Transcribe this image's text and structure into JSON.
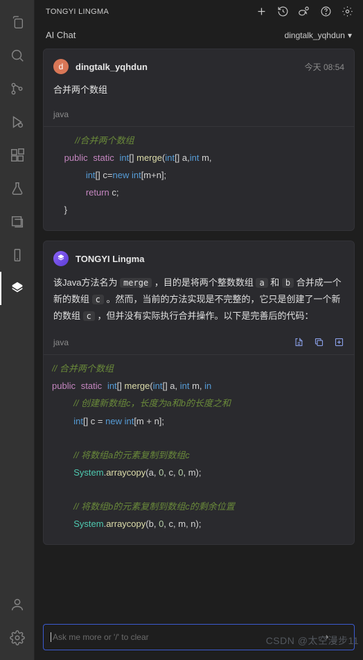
{
  "header": {
    "title": "TONGYI LINGMA",
    "icons": [
      "plus-icon",
      "history-icon",
      "chat-icon",
      "help-icon",
      "gear-icon"
    ],
    "add_label": "+",
    "chat_tab": "AI Chat",
    "user": "dingtalk_yqhdun"
  },
  "activity_bar": {
    "items": [
      {
        "name": "files-icon"
      },
      {
        "name": "search-icon"
      },
      {
        "name": "source-control-icon"
      },
      {
        "name": "run-debug-icon"
      },
      {
        "name": "extensions-icon"
      },
      {
        "name": "beaker-icon"
      },
      {
        "name": "library-icon"
      },
      {
        "name": "device-icon"
      },
      {
        "name": "lingma-icon",
        "active": true
      }
    ],
    "bottom": [
      {
        "name": "account-icon"
      },
      {
        "name": "gear-icon"
      }
    ]
  },
  "messages": {
    "user": {
      "avatar_letter": "d",
      "name": "dingtalk_yqhdun",
      "time": "今天 08:54",
      "text": "合并两个数组",
      "lang": "java",
      "code": {
        "l1": "//合并两个数组",
        "l2a": "public",
        "l2b": "static",
        "l2c": "int",
        "l2d": "[] ",
        "l2e": "merge",
        "l2f": "(",
        "l2g": "int",
        "l2h": "[] a,",
        "l2i": "int",
        "l2j": " m,",
        "l3a": "int",
        "l3b": "[] c=",
        "l3c": "new",
        "l3d": " int",
        "l3e": "[m+n];",
        "l4a": "return",
        "l4b": " c;",
        "l5": "}"
      }
    },
    "assistant": {
      "name": "TONGYI Lingma",
      "explain": {
        "p1a": "该Java方法名为 ",
        "p1_pill1": "merge",
        "p1b": " ，目的是将两个整数数组 ",
        "p1_pill2": "a",
        "p1c": " 和 ",
        "p1_pill3": "b",
        "p1d": " 合并成一个新的数组 ",
        "p1_pill4": "c",
        "p1e": " 。然而，当前的方法实现是不完整的，它只是创建了一个新的数组 ",
        "p1_pill5": "c",
        "p1f": " ，但并没有实际执行合并操作。以下是完善后的代码："
      },
      "lang": "java",
      "actions": [
        "insert-icon",
        "copy-icon",
        "new-file-icon"
      ],
      "code": {
        "l1": "// 合并两个数组",
        "l2": {
          "public": "public",
          "static": "static",
          "int": "int",
          "br": "[] ",
          "fn": "merge",
          "op": "(",
          "i2": "int",
          "a": "[] a, ",
          "i3": "int",
          "m": " m, ",
          "i4": "in"
        },
        "l3": "// 创建新数组c，长度为a和b的长度之和",
        "l4": {
          "int": "int",
          "a": "[] c = ",
          "new": "new",
          "b": " int",
          "c": "[m + n];"
        },
        "l5": "// 将数组a的元素复制到数组c",
        "l6": {
          "sys": "System",
          "dot": ".",
          "fn": "arraycopy",
          "args": "(a, ",
          "n0": "0",
          "c1": ", c, ",
          "n1": "0",
          "c2": ", m);"
        },
        "l7": "// 将数组b的元素复制到数组c的剩余位置",
        "l8": {
          "sys": "System",
          "dot": ".",
          "fn": "arraycopy",
          "args": "(b, ",
          "n0": "0",
          "c1": ", c, m, n);"
        }
      }
    }
  },
  "input": {
    "placeholder": "Ask me more or '/' to clear"
  },
  "watermark": "CSDN @太空漫步11"
}
